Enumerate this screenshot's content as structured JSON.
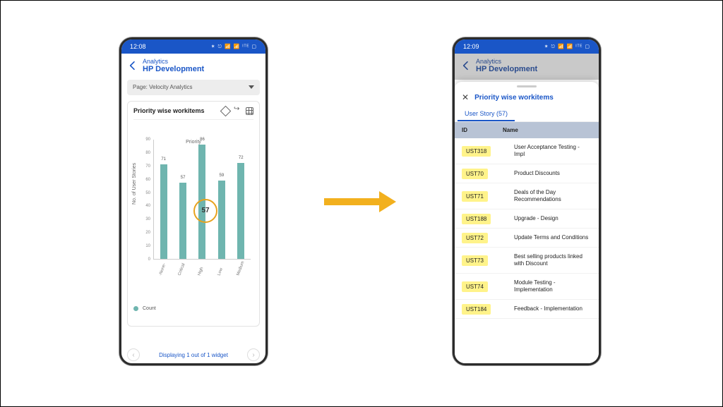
{
  "left": {
    "status": {
      "time": "12:08",
      "icons": "✶ ⎋ 📶 📶 ᴵᵀᴱ ▢"
    },
    "breadcrumb_small": "Analytics",
    "breadcrumb_big": "HP Development",
    "page_selector_label": "Page: Velocity Analytics",
    "card_title": "Priority wise workitems",
    "legend_label": "Count",
    "footer_text": "Displaying 1 out of 1 widget",
    "highlight_value": "57"
  },
  "right": {
    "status": {
      "time": "12:09",
      "icons": "✶ ⎋ 📶 📶 ᴵᵀᴱ ▢"
    },
    "breadcrumb_small": "Analytics",
    "breadcrumb_big": "HP Development",
    "sheet_title": "Priority wise workitems",
    "tab_label": "User Story (57)",
    "col_id": "ID",
    "col_name": "Name",
    "rows": [
      {
        "id": "UST318",
        "name": "User Acceptance Testing - Impl"
      },
      {
        "id": "UST70",
        "name": "Product Discounts"
      },
      {
        "id": "UST71",
        "name": "Deals of the Day Recommendations"
      },
      {
        "id": "UST188",
        "name": "Upgrade - Design"
      },
      {
        "id": "UST72",
        "name": "Update Terms and Conditions"
      },
      {
        "id": "UST73",
        "name": "Best selling products linked with Discount"
      },
      {
        "id": "UST74",
        "name": "Module Testing - Implementation"
      },
      {
        "id": "UST184",
        "name": "Feedback - Implementation"
      }
    ]
  },
  "chart_data": {
    "type": "bar",
    "title": "Priority wise workitems",
    "xlabel": "Priority",
    "ylabel": "No. of User Stories",
    "ylim": [
      0,
      90
    ],
    "y_ticks": [
      0,
      10,
      20,
      30,
      40,
      50,
      60,
      70,
      80,
      90
    ],
    "categories": [
      "-None-",
      "Critical",
      "High",
      "Low",
      "Medium"
    ],
    "values": [
      71,
      57,
      86,
      59,
      72
    ],
    "series_name": "Count",
    "highlight_index": 1,
    "highlight_value": 57
  }
}
